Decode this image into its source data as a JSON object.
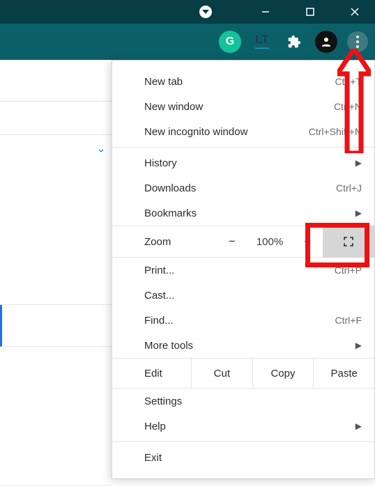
{
  "titlebar": {
    "minimize": "—",
    "maximize": "❐",
    "close": "✕"
  },
  "toolbar": {
    "grammarly_label": "G",
    "lt_label": "LT",
    "lt_wave": "﹏﹏"
  },
  "menu": {
    "new_tab": {
      "label": "New tab",
      "shortcut": "Ctrl+T"
    },
    "new_window": {
      "label": "New window",
      "shortcut": "Ctrl+N"
    },
    "new_incognito": {
      "label": "New incognito window",
      "shortcut": "Ctrl+Shift+N"
    },
    "history": {
      "label": "History"
    },
    "downloads": {
      "label": "Downloads",
      "shortcut": "Ctrl+J"
    },
    "bookmarks": {
      "label": "Bookmarks"
    },
    "zoom": {
      "label": "Zoom",
      "minus": "−",
      "pct": "100%",
      "plus": "+"
    },
    "print": {
      "label": "Print...",
      "shortcut": "Ctrl+P"
    },
    "cast": {
      "label": "Cast..."
    },
    "find": {
      "label": "Find...",
      "shortcut": "Ctrl+F"
    },
    "more_tools": {
      "label": "More tools"
    },
    "edit": {
      "label": "Edit",
      "cut": "Cut",
      "copy": "Copy",
      "paste": "Paste"
    },
    "settings": {
      "label": "Settings"
    },
    "help": {
      "label": "Help"
    },
    "exit": {
      "label": "Exit"
    }
  }
}
